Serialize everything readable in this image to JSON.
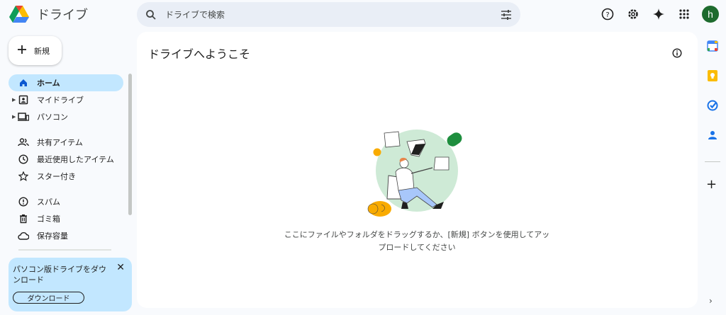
{
  "app": {
    "title": "ドライブ"
  },
  "search": {
    "placeholder": "ドライブで検索"
  },
  "header_icons": [
    "help-icon",
    "settings-icon",
    "gemini-icon",
    "apps-icon"
  ],
  "user": {
    "initial": "h",
    "avatar_color": "#1e6b2e"
  },
  "new_button": {
    "label": "新規"
  },
  "nav": {
    "home": "ホーム",
    "my_drive": "マイドライブ",
    "computers": "パソコン",
    "shared": "共有アイテム",
    "recent": "最近使用したアイテム",
    "starred": "スター付き",
    "spam": "スパム",
    "trash": "ゴミ箱",
    "storage": "保存容量"
  },
  "promo": {
    "text": "パソコン版ドライブをダウンロード",
    "button": "ダウンロード"
  },
  "main": {
    "title": "ドライブへようこそ",
    "empty_text_line1": "ここにファイルやフォルダをドラッグするか、[新規] ボタンを使用してアッ",
    "empty_text_line2": "プロードしてください"
  },
  "colors": {
    "active_nav": "#c2e7ff",
    "search_bg": "#e9eef6",
    "page_bg": "#f8fafd"
  }
}
